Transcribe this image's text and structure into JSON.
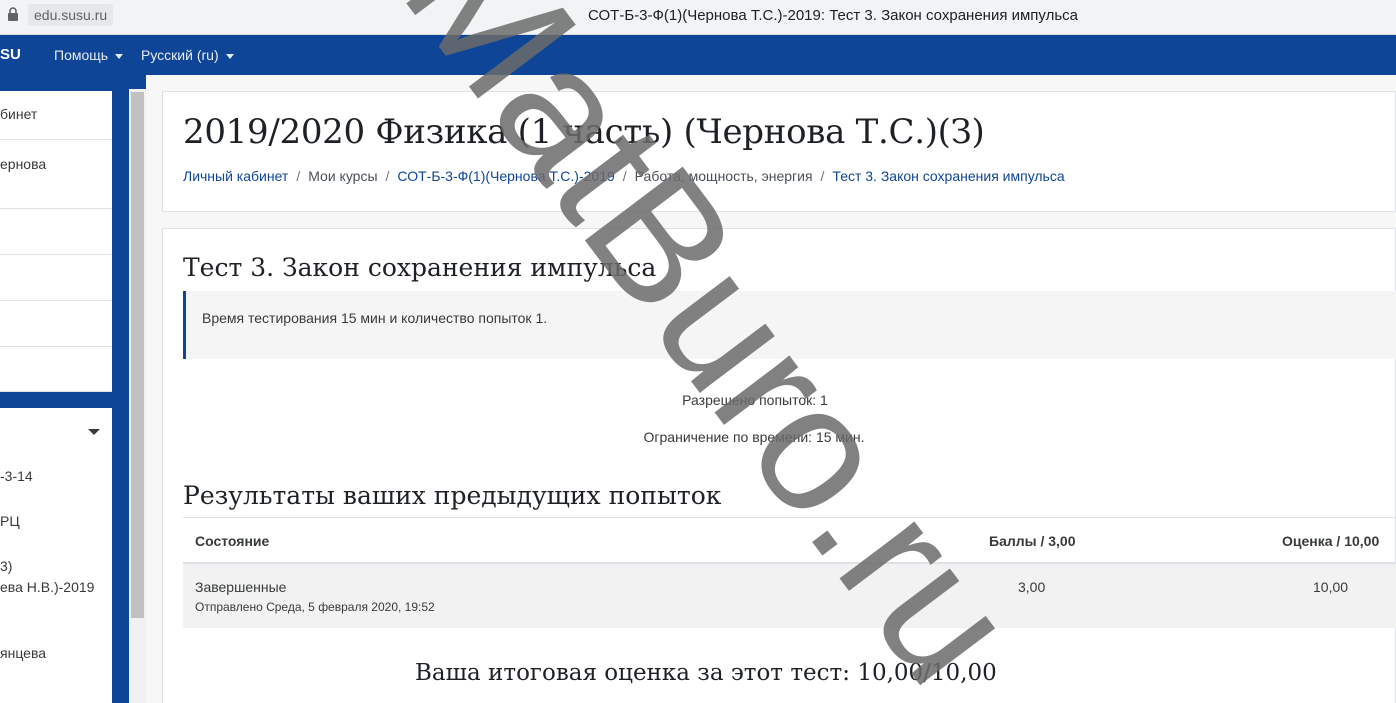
{
  "browser": {
    "url": "edu.susu.ru",
    "tab_title": "СОТ-Б-3-Ф(1)(Чернова Т.С.)-2019: Тест 3. Закон сохранения импульса"
  },
  "navbar": {
    "brand": "SU",
    "help": "Помощь",
    "language": "Русский (ru)",
    "bg_color": "#0f4596"
  },
  "drawer": {
    "items": [
      "бинет",
      "ернова",
      "",
      "",
      "",
      ""
    ],
    "courses": [
      "-3-14",
      "РЦ",
      "3)",
      "ева Н.В.)-2019",
      "янцева"
    ]
  },
  "header": {
    "title": "2019/2020 Физика (1 часть) (Чернова Т.С.)(З)",
    "breadcrumb": [
      "Личный кабинет",
      "Мои курсы",
      "СОТ-Б-3-Ф(1)(Чернова Т.С.)-2019",
      "Работа, мощность, энергия",
      "Тест 3. Закон сохранения импульса"
    ]
  },
  "quiz": {
    "title": "Тест 3. Закон сохранения импульса",
    "intro": "Время тестирования 15 мин и количество попыток 1.",
    "attempts_allowed": "Разрешено попыток: 1",
    "time_limit": "Ограничение по времени: 15 мин.",
    "results_title": "Результаты ваших предыдущих попыток",
    "table": {
      "headers": [
        "Состояние",
        "Баллы / 3,00",
        "Оценка / 10,00"
      ],
      "rows": [
        {
          "status": "Завершенные",
          "submitted": "Отправлено Среда, 5 февраля 2020, 19:52",
          "marks": "3,00",
          "grade": "10,00"
        }
      ]
    },
    "final_grade": "Ваша итоговая оценка за этот тест: 10,00/10,00"
  },
  "watermark": {
    "text": "MatBuro.ru",
    "color": "#6b6b6b"
  }
}
